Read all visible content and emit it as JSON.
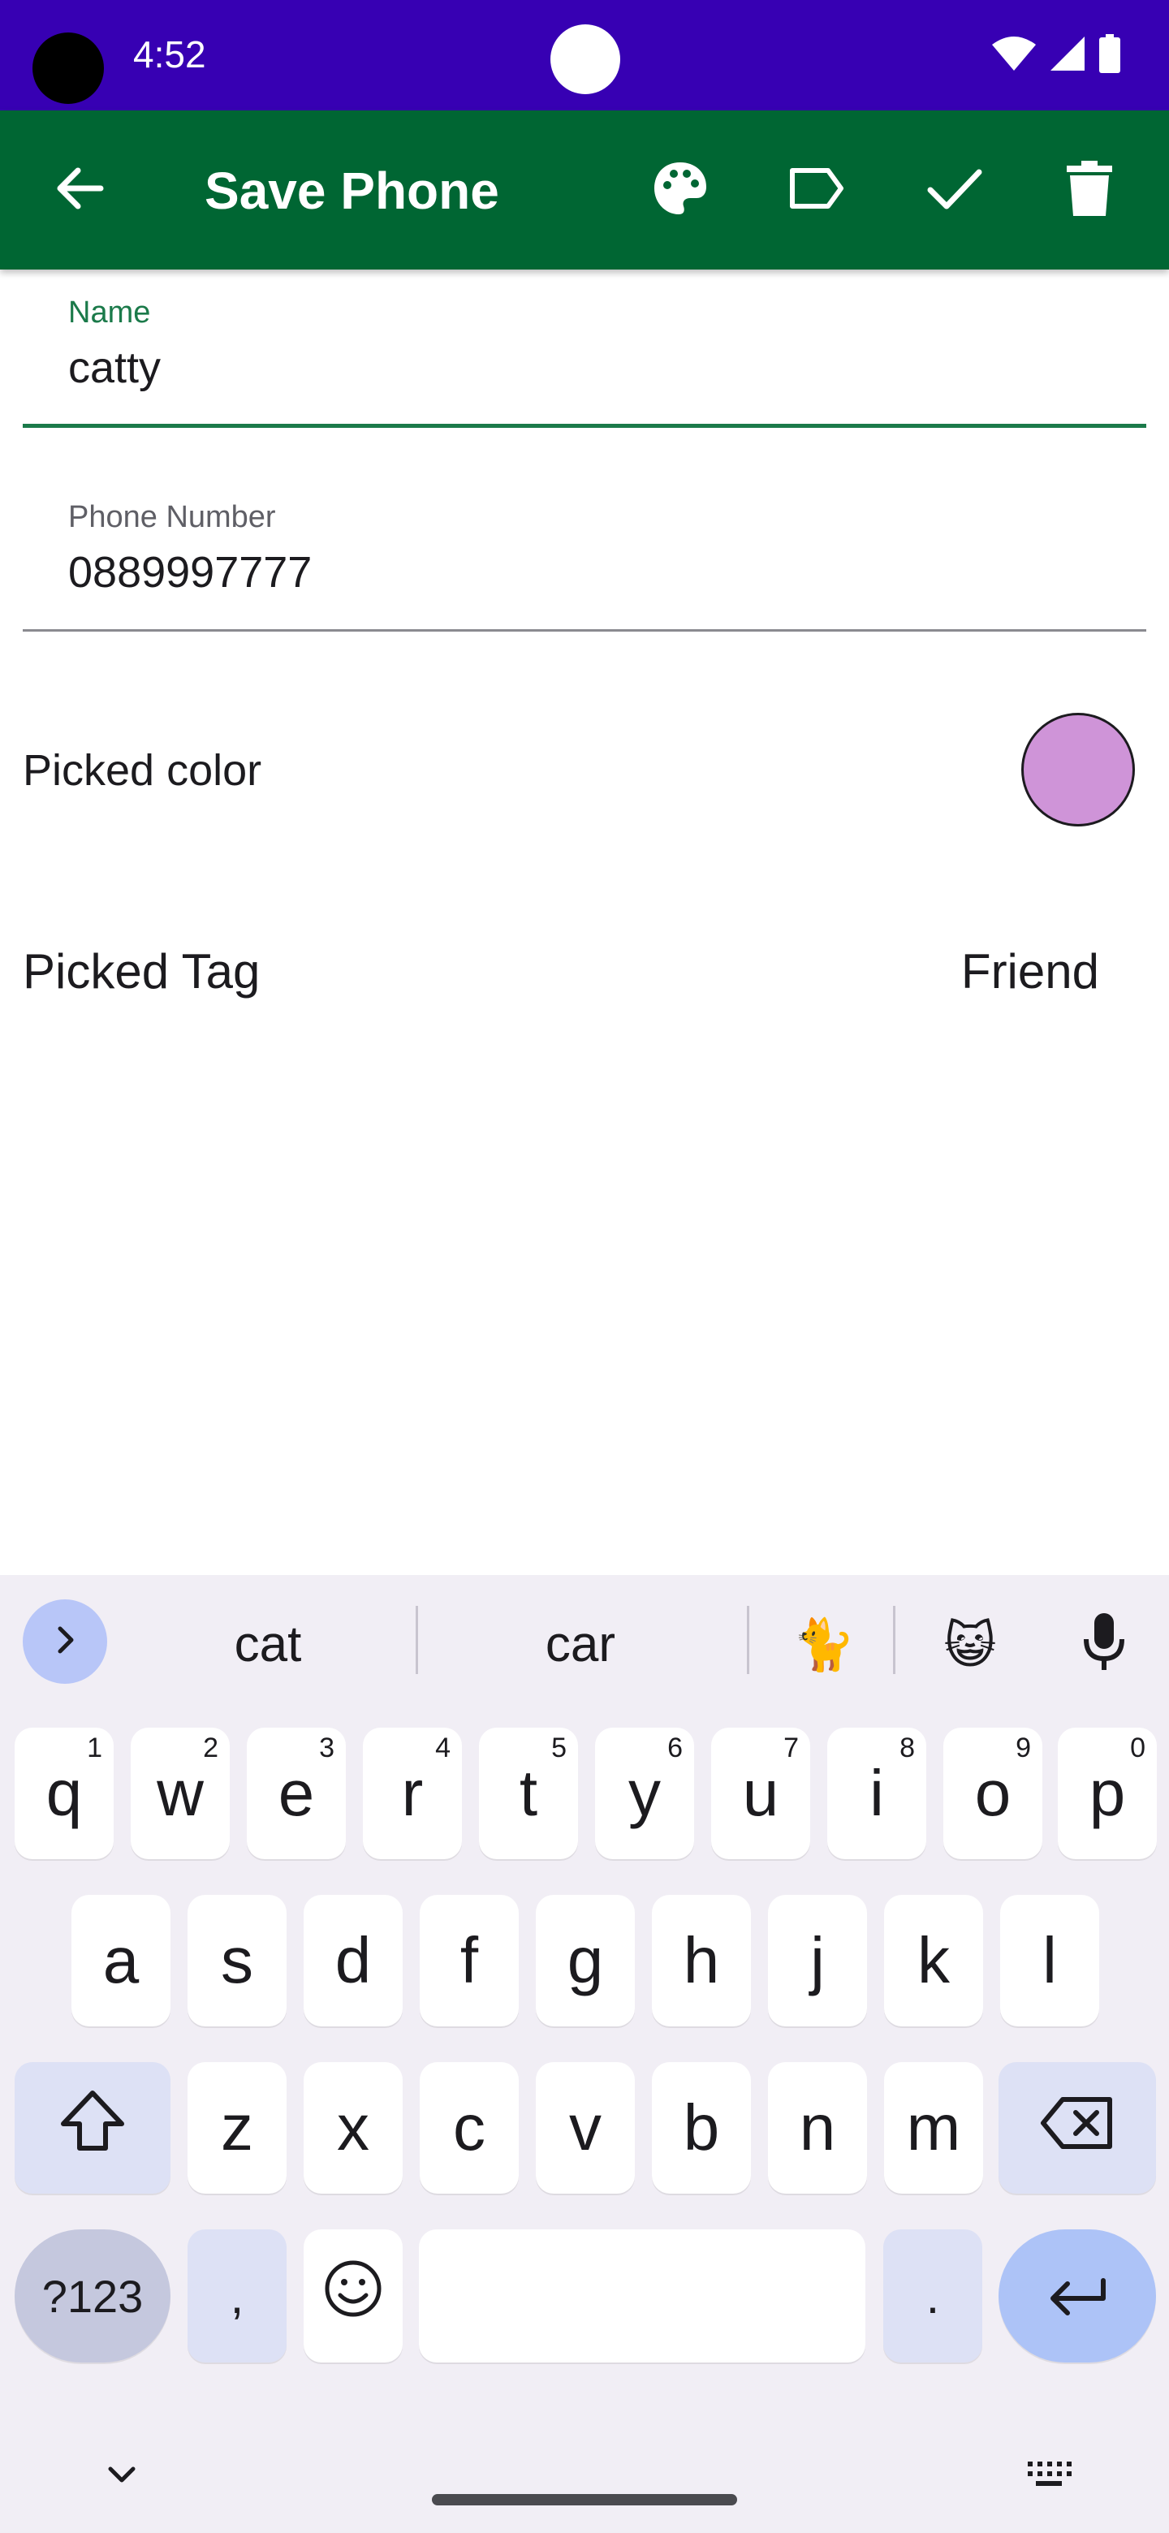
{
  "status_bar": {
    "time": "4:52",
    "icons": [
      "wifi-icon",
      "signal-icon",
      "battery-icon"
    ]
  },
  "app_bar": {
    "title": "Save Phone",
    "actions": [
      "back-arrow-icon",
      "palette-icon",
      "label-icon",
      "check-icon",
      "delete-icon"
    ]
  },
  "form": {
    "name": {
      "label": "Name",
      "value": "catty"
    },
    "phone": {
      "label": "Phone Number",
      "value": "0889997777"
    },
    "color_row": {
      "label": "Picked color",
      "color": "#cf94d8"
    },
    "tag_row": {
      "label": "Picked Tag",
      "value": "Friend"
    }
  },
  "colors": {
    "status_bar": "#3700b3",
    "app_bar": "#006633",
    "accent": "#1b7a4a",
    "picked_color": "#cf94d8"
  },
  "keyboard": {
    "suggestions": [
      "cat",
      "car"
    ],
    "emoji_suggestions": [
      "🐈",
      "😺"
    ],
    "row1": [
      {
        "key": "q",
        "hint": "1"
      },
      {
        "key": "w",
        "hint": "2"
      },
      {
        "key": "e",
        "hint": "3"
      },
      {
        "key": "r",
        "hint": "4"
      },
      {
        "key": "t",
        "hint": "5"
      },
      {
        "key": "y",
        "hint": "6"
      },
      {
        "key": "u",
        "hint": "7"
      },
      {
        "key": "i",
        "hint": "8"
      },
      {
        "key": "o",
        "hint": "9"
      },
      {
        "key": "p",
        "hint": "0"
      }
    ],
    "row2": [
      "a",
      "s",
      "d",
      "f",
      "g",
      "h",
      "j",
      "k",
      "l"
    ],
    "row3": [
      "z",
      "x",
      "c",
      "v",
      "b",
      "n",
      "m"
    ],
    "symbols_label": "?123",
    "comma": ",",
    "period": "."
  }
}
